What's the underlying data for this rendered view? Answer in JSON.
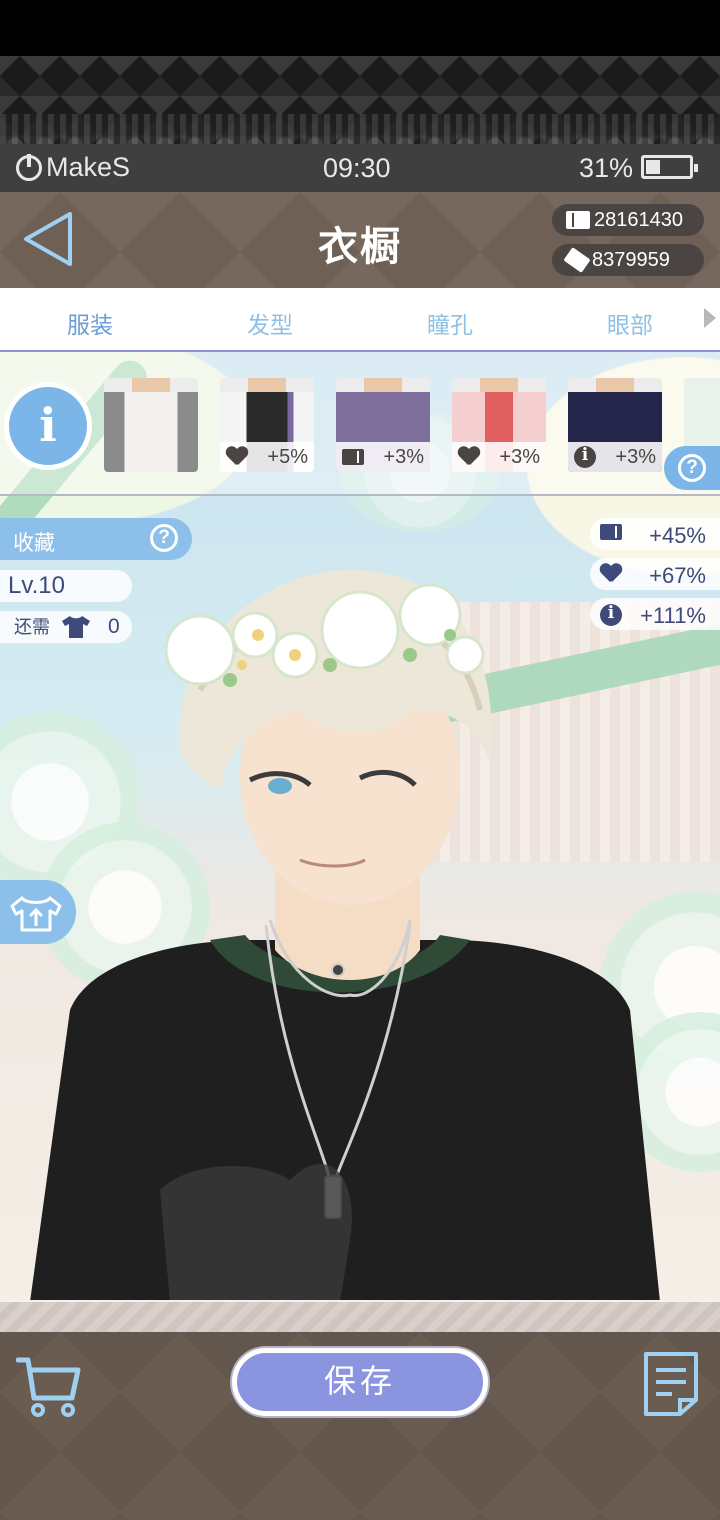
{
  "status": {
    "app": "MakeS",
    "time": "09:30",
    "battery": "31%"
  },
  "header": {
    "title": "衣橱",
    "currency1": "28161430",
    "currency2": "8379959"
  },
  "tabs": [
    {
      "label": "服装",
      "active": true
    },
    {
      "label": "发型",
      "active": false
    },
    {
      "label": "瞳孔",
      "active": false
    },
    {
      "label": "眼部",
      "active": false
    }
  ],
  "info_button": "i",
  "items": [
    {
      "icon": "none",
      "bonus": ""
    },
    {
      "icon": "heart-icon",
      "bonus": "+5%"
    },
    {
      "icon": "book-icon",
      "bonus": "+3%"
    },
    {
      "icon": "heart-icon",
      "bonus": "+3%"
    },
    {
      "icon": "info-icon",
      "bonus": "+3%"
    }
  ],
  "left_panel": {
    "favorite": "收藏",
    "level": "Lv.10",
    "need_label": "还需",
    "need_count": "0"
  },
  "stats": [
    {
      "icon": "book-icon",
      "value": "+45%"
    },
    {
      "icon": "heart-icon",
      "value": "+67%"
    },
    {
      "icon": "info-icon",
      "value": "+111%"
    }
  ],
  "help_mark": "?",
  "bottom": {
    "save": "保存"
  },
  "colors": {
    "accent_blue": "#8cc0ea",
    "save_button": "#8b94df",
    "header_brown": "#6f6055",
    "stat_text": "#3f4a7a"
  }
}
